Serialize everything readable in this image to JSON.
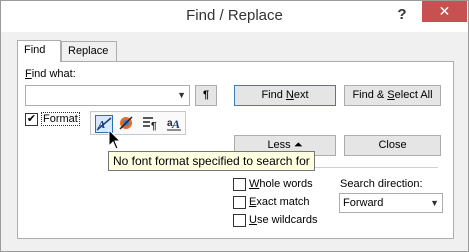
{
  "window": {
    "title": "Find / Replace",
    "help_label": "?",
    "close_label": "✕"
  },
  "tabs": [
    {
      "label": "Find"
    },
    {
      "label": "Replace"
    }
  ],
  "find": {
    "label_prefix": "F",
    "label_rest": "ind what:",
    "value": "",
    "paragraph_button": "¶"
  },
  "buttons": {
    "find_next_pre": "Find ",
    "find_next_u": "N",
    "find_next_post": "ext",
    "find_select_pre": "Find & ",
    "find_select_u": "S",
    "find_select_post": "elect All",
    "less": "Less",
    "less_icon": "⏶",
    "close": "Close"
  },
  "format": {
    "label": "Format",
    "checked": true,
    "check_mark": "✔"
  },
  "format_toolbar": {
    "icons": [
      "font-format-icon",
      "highlight-color-icon",
      "paragraph-format-icon",
      "character-style-icon"
    ]
  },
  "tooltip": {
    "text": "No font format specified to search for"
  },
  "options": [
    {
      "u": "W",
      "rest": "hole words",
      "checked": false
    },
    {
      "u": "E",
      "rest": "xact match",
      "checked": false
    },
    {
      "u": "U",
      "rest": "se wildcards",
      "checked": false
    }
  ],
  "search_direction": {
    "label": "Search direction:",
    "value": "Forward"
  }
}
